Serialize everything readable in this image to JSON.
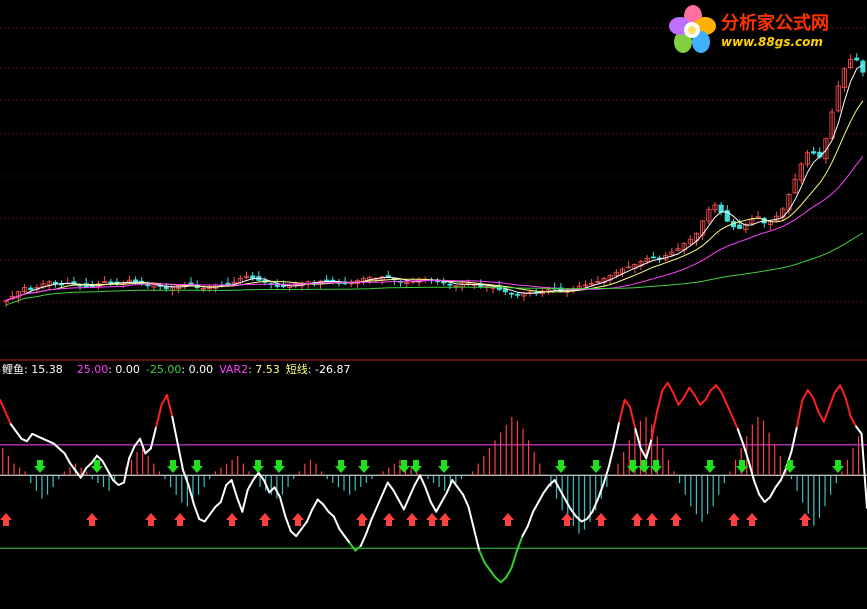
{
  "colors": {
    "background": "#000000",
    "grid": "#7a1515",
    "separator": "#b02020",
    "up_candle": "#ff5050",
    "down_candle": "#40e0e0",
    "ma_short": "#ffffff",
    "ma_mid": "#ffff80",
    "ma_long": "#ff40ff",
    "ma_longest": "#40d040",
    "line_high": "#ff2020",
    "line_mid": "#ffffff",
    "line_low": "#30d030",
    "level_upper": "#ff40ff",
    "level_lower": "#40d040",
    "bar_pos": "#ff4040",
    "bar_neg": "#40c0c0",
    "arrow_up": "#ff4040",
    "arrow_down": "#20e020"
  },
  "logo": {
    "title": "分析家公式网",
    "url": "www.88gs.com",
    "icon": "flower-logo-icon"
  },
  "indicator_legend": {
    "name": "鲤鱼",
    "name_value": ": 15.38",
    "upper_level": "25.00",
    "upper_sep": ": 0.00",
    "lower_level": "-25.00",
    "lower_sep": ": 0.00",
    "var2_label": "VAR2",
    "var2_value": ": 7.53",
    "short_label": "短线",
    "short_value": ": -26.87"
  },
  "chart_data": [
    {
      "type": "candlestick",
      "title": "",
      "description_series": [
        "price",
        "MA short",
        "MA mid",
        "MA long",
        "MA longest"
      ],
      "grid": true,
      "closes": [
        10.2,
        10.6,
        11.1,
        10.9,
        11.3,
        11.5,
        11.2,
        11.4,
        11.3,
        11.1,
        11.2,
        11.5,
        11.4,
        11.3,
        11.6,
        11.4,
        11.2,
        11.3,
        11.0,
        11.1,
        11.3,
        11.2,
        11.0,
        11.1,
        11.3,
        11.2,
        11.5,
        11.9,
        11.7,
        11.5,
        11.3,
        11.1,
        11.2,
        11.3,
        11.5,
        11.4,
        11.6,
        11.5,
        11.3,
        11.4,
        11.6,
        11.8,
        11.7,
        11.9,
        11.6,
        11.4,
        11.5,
        11.7,
        11.6,
        11.5,
        11.3,
        11.2,
        11.4,
        11.3,
        11.1,
        11.2,
        10.9,
        10.7,
        10.6,
        10.8,
        10.7,
        10.9,
        11.0,
        10.8,
        10.9,
        11.2,
        11.3,
        11.5,
        11.8,
        12.1,
        12.4,
        12.6,
        12.9,
        13.2,
        13.0,
        13.4,
        13.7,
        14.2,
        14.6,
        15.8,
        16.9,
        16.2,
        15.3,
        15.1,
        15.5,
        16.0,
        15.4,
        15.8,
        16.5,
        18.0,
        19.5,
        20.6,
        19.8,
        21.6,
        24.5,
        26.2,
        27.0,
        25.8
      ],
      "volume_hint": false
    },
    {
      "type": "line",
      "title": "鲤鱼",
      "levels": [
        25.0,
        0.0,
        -25.0
      ],
      "short_line": [
        62,
        52,
        42,
        36,
        30,
        28,
        34,
        32,
        30,
        28,
        26,
        22,
        18,
        10,
        4,
        -2,
        6,
        10,
        16,
        12,
        4,
        -4,
        -8,
        -6,
        14,
        24,
        30,
        18,
        22,
        40,
        58,
        66,
        48,
        26,
        4,
        -8,
        -24,
        -36,
        -38,
        -32,
        -26,
        -22,
        -8,
        -4,
        -18,
        -30,
        -12,
        -4,
        2,
        -4,
        -14,
        -10,
        -18,
        -34,
        -46,
        -50,
        -44,
        -38,
        -28,
        -20,
        -24,
        -30,
        -34,
        -44,
        -50,
        -56,
        -62,
        -58,
        -48,
        -36,
        -26,
        -16,
        -6,
        -12,
        -20,
        -28,
        -18,
        -8,
        0,
        -10,
        -22,
        -30,
        -22,
        -14,
        -4,
        -10,
        -16,
        -26,
        -44,
        -62,
        -72,
        -78,
        -84,
        -88,
        -84,
        -76,
        -62,
        -50,
        -42,
        -30,
        -22,
        -14,
        -8,
        -4,
        -12,
        -20,
        -28,
        -34,
        -38,
        -36,
        -30,
        -20,
        -8,
        6,
        24,
        44,
        62,
        56,
        38,
        22,
        14,
        30,
        52,
        70,
        76,
        68,
        58,
        64,
        72,
        66,
        58,
        62,
        70,
        74,
        68,
        58,
        48,
        38,
        26,
        12,
        -4,
        -16,
        -22,
        -18,
        -10,
        -4,
        6,
        20,
        40,
        62,
        70,
        64,
        52,
        44,
        56,
        68,
        74,
        64,
        48,
        40,
        34,
        -26.87
      ],
      "bars": [
        14,
        10,
        6,
        4,
        2,
        -4,
        -8,
        -12,
        -10,
        -6,
        -2,
        2,
        4,
        6,
        4,
        2,
        -2,
        -4,
        -6,
        -8,
        -4,
        0,
        4,
        8,
        12,
        14,
        10,
        6,
        2,
        -2,
        -6,
        -10,
        -14,
        -16,
        -14,
        -10,
        -6,
        -2,
        2,
        4,
        6,
        8,
        10,
        6,
        2,
        -2,
        -6,
        -8,
        -10,
        -12,
        -10,
        -6,
        -2,
        2,
        6,
        8,
        6,
        2,
        -2,
        -4,
        -6,
        -8,
        -10,
        -8,
        -6,
        -4,
        -2,
        0,
        2,
        4,
        6,
        8,
        6,
        4,
        2,
        0,
        -2,
        -4,
        -6,
        -8,
        -6,
        -4,
        -2,
        0,
        2,
        6,
        10,
        14,
        18,
        22,
        26,
        30,
        28,
        24,
        18,
        12,
        6,
        0,
        -6,
        -12,
        -18,
        -22,
        -26,
        -30,
        -28,
        -24,
        -18,
        -12,
        -6,
        0,
        6,
        12,
        18,
        24,
        28,
        30,
        26,
        20,
        14,
        8,
        2,
        -4,
        -10,
        -16,
        -20,
        -24,
        -20,
        -16,
        -10,
        -4,
        2,
        8,
        14,
        20,
        26,
        30,
        28,
        22,
        16,
        10,
        4,
        -2,
        -8,
        -14,
        -20,
        -26,
        -22,
        -16,
        -10,
        -4,
        2,
        8,
        14,
        20,
        7.53
      ]
    }
  ]
}
